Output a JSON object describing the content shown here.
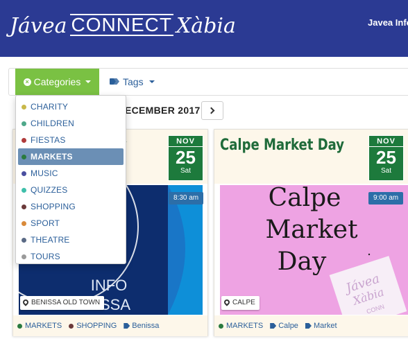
{
  "header": {
    "logo_left": "Jávea",
    "logo_middle": "CONNECT",
    "logo_right": "Xàbia",
    "link": "Javea Info"
  },
  "filters": {
    "categories_label": "Categories",
    "tags_label": "Tags"
  },
  "calendar": {
    "month_label": "ECEMBER 2017"
  },
  "categories_menu": [
    {
      "label": "CHARITY",
      "color": "#c9b84a"
    },
    {
      "label": "CHILDREN",
      "color": "#4fa88a"
    },
    {
      "label": "FIESTAS",
      "color": "#b03a3a"
    },
    {
      "label": "MARKETS",
      "color": "#2a7a3f",
      "active": true
    },
    {
      "label": "MUSIC",
      "color": "#4a4fa0"
    },
    {
      "label": "QUIZZES",
      "color": "#3fbfaa"
    },
    {
      "label": "SHOPPING",
      "color": "#6b3a3a"
    },
    {
      "label": "SPORT",
      "color": "#d98a3a"
    },
    {
      "label": "THEATRE",
      "color": "#5a6a85"
    },
    {
      "label": "TOURS",
      "color": "#9a9a9a"
    }
  ],
  "events": [
    {
      "title": "y",
      "month": "NOV",
      "day": "25",
      "weekday": "Sat",
      "time": "8:30 am",
      "location": "BENISSA OLD TOWN",
      "image_text": [
        "INFO",
        "NISSA"
      ],
      "tags": [
        {
          "type": "category",
          "label": "MARKETS",
          "color": "#2a7a3f"
        },
        {
          "type": "category",
          "label": "SHOPPING",
          "color": "#6b3a3a"
        },
        {
          "type": "tag",
          "label": "Benissa"
        }
      ]
    },
    {
      "title": "Calpe Market Day",
      "month": "NOV",
      "day": "25",
      "weekday": "Sat",
      "time": "9:00 am",
      "location": "CALPE",
      "image_text": [
        "Calpe",
        "Market",
        "Day"
      ],
      "image_stamp": [
        "Jávea",
        "Xàbia",
        "CONN"
      ],
      "tags": [
        {
          "type": "category",
          "label": "MARKETS",
          "color": "#2a7a3f"
        },
        {
          "type": "tag",
          "label": "Calpe"
        },
        {
          "type": "tag",
          "label": "Market"
        }
      ]
    }
  ]
}
